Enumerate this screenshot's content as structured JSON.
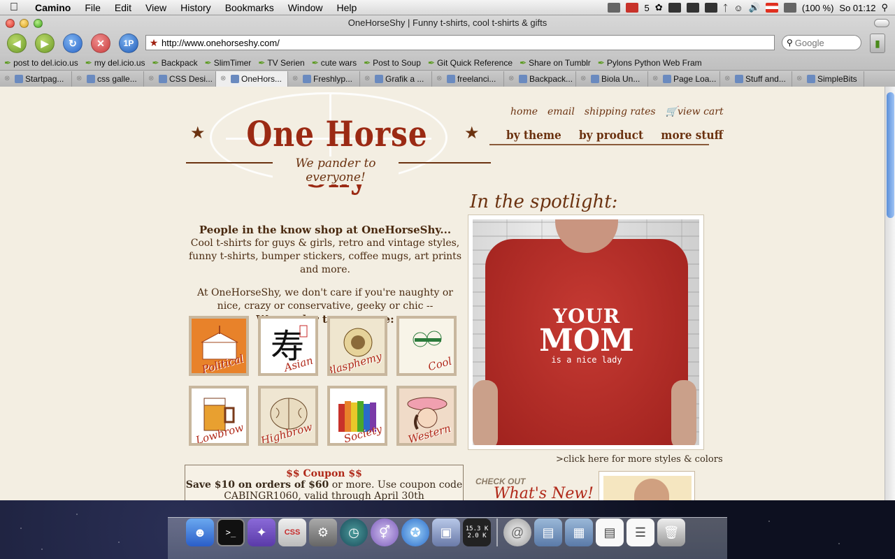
{
  "menubar": {
    "app": "Camino",
    "items": [
      "File",
      "Edit",
      "View",
      "History",
      "Bookmarks",
      "Window",
      "Help"
    ],
    "status": {
      "mail_count": "5",
      "battery": "(100 %)",
      "clock": "So 01:12"
    }
  },
  "window": {
    "title": "OneHorseShy | Funny t-shirts, cool t-shirts & gifts"
  },
  "toolbar": {
    "url": "http://www.onehorseshy.com/",
    "search_placeholder": "Google",
    "onepassword_label": "1P"
  },
  "bookmarks": [
    "post to del.icio.us",
    "my del.icio.us",
    "Backpack",
    "SlimTimer",
    "TV Serien",
    "cute wars",
    "Post to Soup",
    "Git Quick Reference",
    "Share on Tumblr",
    "Pylons Python Web Fram"
  ],
  "tabs": [
    {
      "label": "Startpag...",
      "active": false
    },
    {
      "label": "css galle...",
      "active": false
    },
    {
      "label": "CSS Desi...",
      "active": false
    },
    {
      "label": "OneHors...",
      "active": true
    },
    {
      "label": "Freshlyp...",
      "active": false
    },
    {
      "label": "Grafik a ...",
      "active": false
    },
    {
      "label": "freelanci...",
      "active": false
    },
    {
      "label": "Backpack...",
      "active": false
    },
    {
      "label": "Biola Un...",
      "active": false
    },
    {
      "label": "Page Loa...",
      "active": false
    },
    {
      "label": "Stuff and...",
      "active": false
    },
    {
      "label": "SimpleBits",
      "active": false
    }
  ],
  "site": {
    "logo": "One Horse Shy",
    "tagline": "We pander to everyone!",
    "topnav": [
      "home",
      "email",
      "shipping rates",
      "view cart"
    ],
    "mainnav": [
      "by theme",
      "by product",
      "more stuff"
    ],
    "intro": {
      "heading": "People in the know shop at OneHorseShy...",
      "text1": "Cool t-shirts for guys & girls, retro and vintage styles, funny t-shirts, bumper stickers, coffee mugs, art prints and more.",
      "text2": "At OneHorseShy, we don't care if you're naughty or nice, crazy or conservative, geeky or chic --",
      "text3": "We pander to everyone:"
    },
    "categories": [
      "Political",
      "Asian",
      "Blasphemy",
      "Cool",
      "Lowbrow",
      "Highbrow",
      "Society",
      "Western"
    ],
    "coupon": {
      "title": "$$ Coupon $$",
      "bold": "Save $10 on orders of $60",
      "rest": " or more. Use coupon code",
      "line3": "CABINGR1060, valid through April 30th"
    },
    "spotlight": {
      "title": "In the spotlight:",
      "shirt_line1": "YOUR",
      "shirt_line2": "MOM",
      "shirt_line3": "is a nice lady",
      "more_link": ">click here for more styles & colors"
    },
    "whats_new": {
      "kicker": "CHECK OUT",
      "title": "What's New!"
    }
  },
  "dock": {
    "meter_top": "15.3 K",
    "meter_bottom": "2.0 K"
  }
}
